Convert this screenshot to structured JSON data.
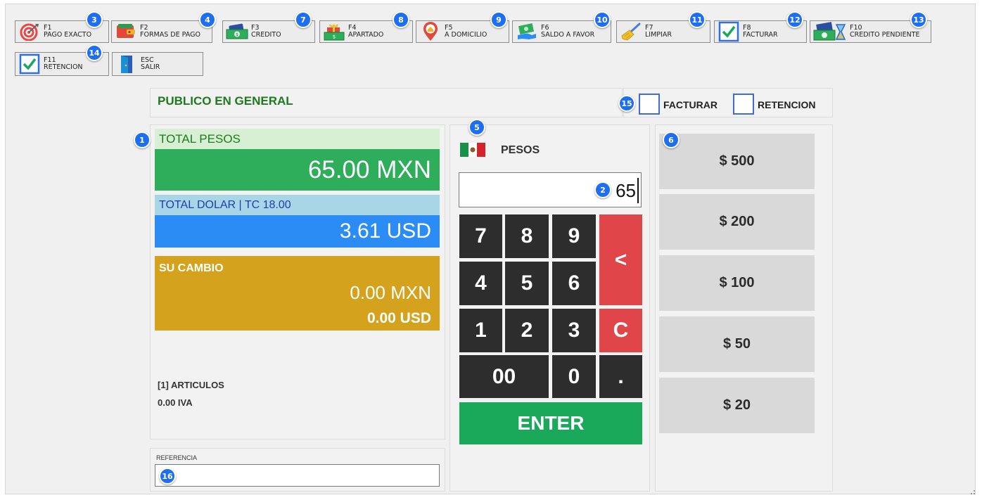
{
  "toolbar": {
    "buttons": [
      {
        "key": "F1",
        "label": "PAGO EXACTO",
        "badge": "3",
        "icon": "target-icon"
      },
      {
        "key": "F2",
        "label": "FORMAS DE PAGO",
        "badge": "4",
        "icon": "wallet-icon"
      },
      {
        "key": "F3",
        "label": "CREDITO",
        "badge": "7",
        "icon": "credit-money-icon"
      },
      {
        "key": "F4",
        "label": "APARTADO",
        "badge": "8",
        "icon": "gift-money-icon"
      },
      {
        "key": "F5",
        "label": "A DOMICILIO",
        "badge": "9",
        "icon": "home-location-icon"
      },
      {
        "key": "F6",
        "label": "SALDO A FAVOR",
        "badge": "10",
        "icon": "cash-hand-icon"
      },
      {
        "key": "F7",
        "label": "LIMPIAR",
        "badge": "11",
        "icon": "broom-icon"
      },
      {
        "key": "F8",
        "label": "FACTURAR",
        "badge": "12",
        "icon": "checkbox-icon"
      },
      {
        "key": "F10",
        "label": "CREDITO PENDIENTE",
        "badge": "13",
        "icon": "hourglass-money-icon"
      },
      {
        "key": "F11",
        "label": "RETENCION",
        "badge": "14",
        "icon": "checkbox-icon"
      },
      {
        "key": "ESC",
        "label": "SALIR",
        "badge": "",
        "icon": "exit-door-icon"
      }
    ]
  },
  "customer": {
    "name": "PUBLICO EN GENERAL",
    "badge": "15",
    "facturar_label": "FACTURAR",
    "retencion_label": "RETENCION"
  },
  "totals": {
    "badge": "1",
    "pesos_label": "TOTAL PESOS",
    "pesos_value": "65.00 MXN",
    "dolar_label": "TOTAL DOLAR | TC 18.00",
    "dolar_value": "3.61 USD",
    "cambio_label": "SU CAMBIO",
    "cambio_mxn": "0.00 MXN",
    "cambio_usd": "0.00 USD",
    "articulos": "[1] ARTICULOS",
    "iva": "0.00 IVA"
  },
  "referencia": {
    "label": "REFERENCIA",
    "badge": "16",
    "value": ""
  },
  "keypad": {
    "currency_badge": "5",
    "currency_label": "PESOS",
    "amount_badge": "2",
    "amount_value": "65",
    "keys": [
      "7",
      "8",
      "9",
      "4",
      "5",
      "6",
      "1",
      "2",
      "3",
      "00",
      "0",
      "."
    ],
    "backspace": "<",
    "clear": "C",
    "enter": "ENTER"
  },
  "quick_amounts": {
    "badge": "6",
    "amounts": [
      "$ 500",
      "$ 200",
      "$ 100",
      "$ 50",
      "$ 20"
    ]
  },
  "colors": {
    "green": "#2ead5a",
    "blue": "#2c8cf5",
    "gold": "#d4a21c",
    "red": "#e0454a",
    "badge": "#1e6ff0"
  }
}
